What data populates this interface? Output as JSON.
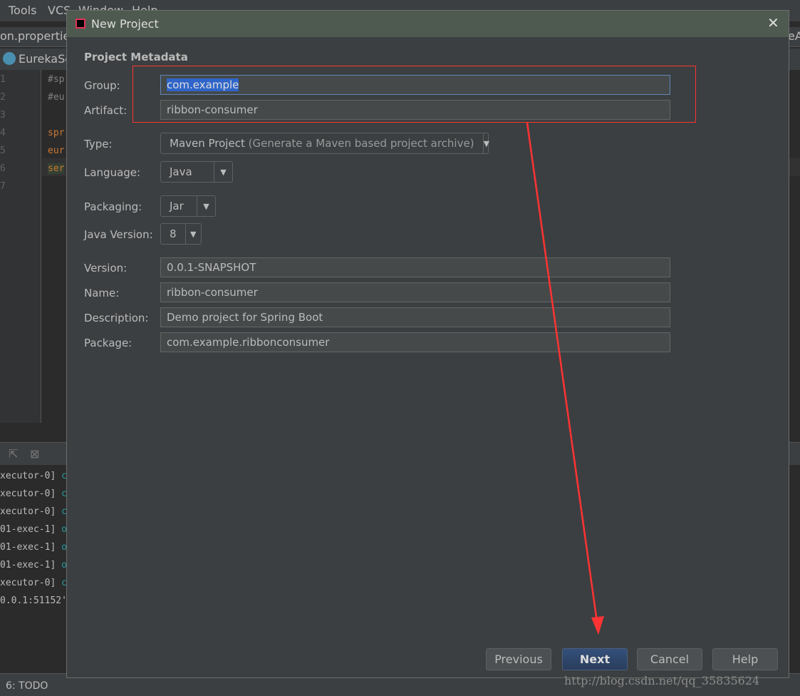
{
  "ide": {
    "menu": [
      "Tools",
      "VCS",
      "Window",
      "Help"
    ],
    "file_tab": "on.propertie",
    "right_tab": "eA",
    "nav_item": "EurekaSe",
    "line_numbers": [
      "1",
      "2",
      "3",
      "4",
      "5",
      "6",
      "7"
    ],
    "code_lines": [
      {
        "text": "#sp",
        "color": "#808080"
      },
      {
        "text": "#eu",
        "color": "#808080"
      },
      {
        "text": "",
        "color": "#808080"
      },
      {
        "text": "spr",
        "color": "#cc7832"
      },
      {
        "text": "eur",
        "color": "#cc7832"
      },
      {
        "text": "ser",
        "color": "#cc7832"
      }
    ],
    "console_lines": [
      {
        "prefix": "xecutor-0]",
        "suffix": "c"
      },
      {
        "prefix": "xecutor-0]",
        "suffix": "c"
      },
      {
        "prefix": "xecutor-0]",
        "suffix": "c"
      },
      {
        "prefix": "01-exec-1]",
        "suffix": "o"
      },
      {
        "prefix": "01-exec-1]",
        "suffix": "o"
      },
      {
        "prefix": "01-exec-1]",
        "suffix": "o"
      },
      {
        "prefix": "xecutor-0]",
        "suffix": "c"
      },
      {
        "prefix": "0.0.1:51152'",
        "suffix": ""
      }
    ],
    "status_todo": "6: TODO"
  },
  "dialog": {
    "title": "New Project",
    "section": "Project Metadata",
    "fields": {
      "group": {
        "label": "Group:",
        "value": "com.example"
      },
      "artifact": {
        "label": "Artifact:",
        "value": "ribbon-consumer"
      },
      "type": {
        "label": "Type:",
        "value": "Maven Project",
        "hint": "(Generate a Maven based project archive)"
      },
      "language": {
        "label": "Language:",
        "value": "Java"
      },
      "packaging": {
        "label": "Packaging:",
        "value": "Jar"
      },
      "java_version": {
        "label": "Java Version:",
        "value": "8"
      },
      "version": {
        "label": "Version:",
        "value": "0.0.1-SNAPSHOT"
      },
      "name": {
        "label": "Name:",
        "value": "ribbon-consumer"
      },
      "description": {
        "label": "Description:",
        "value": "Demo project for Spring Boot"
      },
      "package": {
        "label": "Package:",
        "value": "com.example.ribbonconsumer"
      }
    },
    "buttons": {
      "previous": "Previous",
      "next": "Next",
      "cancel": "Cancel",
      "help": "Help"
    }
  },
  "watermark": "http://blog.csdn.net/qq_35835624",
  "colors": {
    "accent": "#2f65ca",
    "annotation": "#ff3333",
    "next_button": "#2d4466"
  }
}
